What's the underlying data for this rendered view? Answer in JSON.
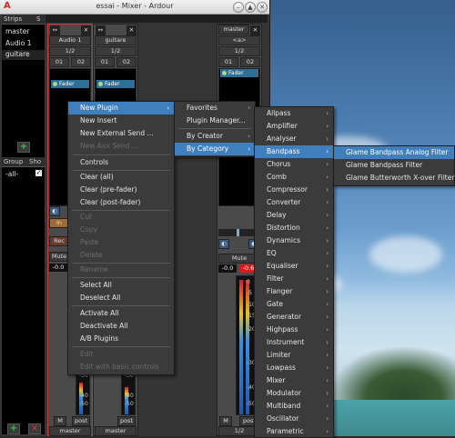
{
  "window": {
    "title": "essai - Mixer - Ardour"
  },
  "strips_panel": {
    "col_strips": "Strips",
    "col_show": "S",
    "items": [
      "master",
      "Audio 1",
      "guitare"
    ],
    "group_headers": [
      "Group",
      "Sho"
    ],
    "group_items": [
      "-all-"
    ]
  },
  "strip_audio1": {
    "name": "Audio 1",
    "input": "1/2",
    "in1": "01",
    "in2": "02",
    "plugin": "Fader",
    "button_in": "In",
    "button_rec": "Rec",
    "button_mute": "Mute",
    "gain": "-0.0",
    "scale": [
      "-30",
      "-40",
      "-50"
    ],
    "m": "M",
    "post": "post",
    "output": "master"
  },
  "strip_guitare": {
    "name": "guitare",
    "input": "1/2",
    "in1": "01",
    "in2": "02",
    "plugin": "Fader",
    "scale": [
      "-30",
      "-40",
      "-50"
    ],
    "post": "post",
    "output": "master"
  },
  "strip_master": {
    "name": "master",
    "input": "<a>",
    "io": "1/2",
    "in1": "01",
    "in2": "02",
    "plugin": "Fader",
    "button_mute": "Mute",
    "gain": "-0.0",
    "peak": "-0.6",
    "scale": [
      "0",
      "-5",
      "-10",
      "-15",
      "-20",
      "-30",
      "-40",
      "-50"
    ],
    "m": "M",
    "post": "post",
    "output": "1/2"
  },
  "context_menu": [
    {
      "label": "New Plugin",
      "submenu": true,
      "highlighted": true
    },
    {
      "label": "New Insert"
    },
    {
      "label": "New External Send ..."
    },
    {
      "label": "New Aux Send ...",
      "disabled": true
    },
    {
      "separator": true
    },
    {
      "label": "Controls"
    },
    {
      "separator": true
    },
    {
      "label": "Clear (all)"
    },
    {
      "label": "Clear (pre-fader)"
    },
    {
      "label": "Clear (post-fader)"
    },
    {
      "separator": true
    },
    {
      "label": "Cut",
      "disabled": true
    },
    {
      "label": "Copy",
      "disabled": true
    },
    {
      "label": "Paste",
      "disabled": true
    },
    {
      "label": "Delete",
      "disabled": true
    },
    {
      "separator": true
    },
    {
      "label": "Rename",
      "disabled": true
    },
    {
      "separator": true
    },
    {
      "label": "Select All"
    },
    {
      "label": "Deselect All"
    },
    {
      "separator": true
    },
    {
      "label": "Activate All"
    },
    {
      "label": "Deactivate All"
    },
    {
      "label": "A/B Plugins"
    },
    {
      "separator": true
    },
    {
      "label": "Edit",
      "disabled": true
    },
    {
      "label": "Edit with basic controls",
      "disabled": true
    }
  ],
  "plugin_submenu": [
    {
      "label": "Favorites",
      "submenu": true
    },
    {
      "label": "Plugin Manager..."
    },
    {
      "separator": true
    },
    {
      "label": "By Creator",
      "submenu": true
    },
    {
      "label": "By Category",
      "submenu": true,
      "highlighted": true
    }
  ],
  "category_submenu": [
    {
      "label": "Allpass"
    },
    {
      "label": "Amplifier"
    },
    {
      "label": "Analyser"
    },
    {
      "label": "Bandpass",
      "highlighted": true
    },
    {
      "label": "Chorus"
    },
    {
      "label": "Comb"
    },
    {
      "label": "Compressor"
    },
    {
      "label": "Converter"
    },
    {
      "label": "Delay"
    },
    {
      "label": "Distortion"
    },
    {
      "label": "Dynamics"
    },
    {
      "label": "EQ"
    },
    {
      "label": "Equaliser"
    },
    {
      "label": "Filter"
    },
    {
      "label": "Flanger"
    },
    {
      "label": "Gate"
    },
    {
      "label": "Generator"
    },
    {
      "label": "Highpass"
    },
    {
      "label": "Instrument"
    },
    {
      "label": "Limiter"
    },
    {
      "label": "Lowpass"
    },
    {
      "label": "Mixer"
    },
    {
      "label": "Modulator"
    },
    {
      "label": "Multiband"
    },
    {
      "label": "Oscillator"
    },
    {
      "label": "Parametric"
    }
  ],
  "bandpass_submenu": [
    {
      "label": "Glame Bandpass Analog Filter",
      "highlighted": true
    },
    {
      "label": "Glame Bandpass Filter"
    },
    {
      "label": "Glame Butterworth X-over Filter"
    }
  ],
  "colors": {
    "menu_highlight": "#3f7fbd",
    "selected_strip_border": "#c83a3a",
    "fader_plugin": "#2d6f96",
    "peak_red": "#e01818"
  }
}
